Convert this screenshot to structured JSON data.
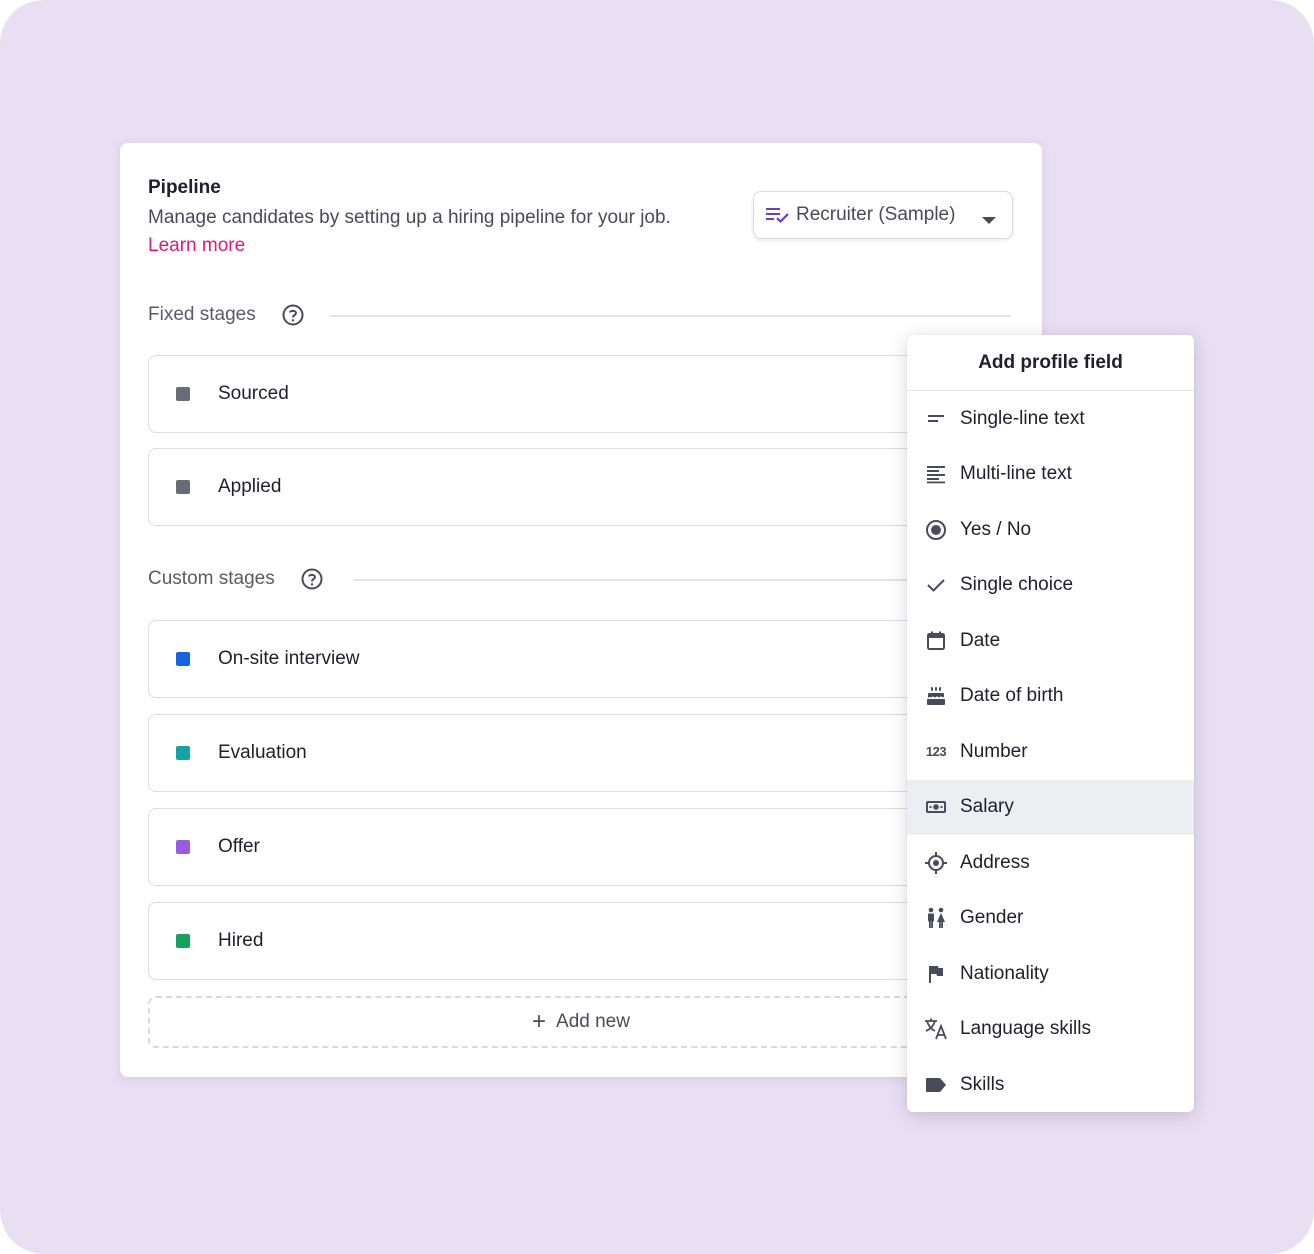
{
  "pipeline": {
    "title": "Pipeline",
    "description": "Manage candidates by setting up a hiring pipeline for your job.",
    "learn_more": "Learn more",
    "template_select": {
      "value": "Recruiter (Sample)",
      "icon": "playlist-check-icon",
      "accent": "#6b3fb8"
    }
  },
  "fixed_stages": {
    "label": "Fixed stages",
    "items": [
      {
        "label": "Sourced",
        "color": "#6b6b78"
      },
      {
        "label": "Applied",
        "color": "#6b6b78"
      }
    ]
  },
  "custom_stages": {
    "label": "Custom stages",
    "items": [
      {
        "label": "On-site interview",
        "color": "#1464e0"
      },
      {
        "label": "Evaluation",
        "color": "#12a3a3"
      },
      {
        "label": "Offer",
        "color": "#9a5ae0"
      },
      {
        "label": "Hired",
        "color": "#16a05a"
      }
    ]
  },
  "add_new": {
    "label": "Add new"
  },
  "profile_field_menu": {
    "title": "Add profile field",
    "highlighted": "Salary",
    "items": [
      {
        "label": "Single-line text",
        "icon": "short-text-icon"
      },
      {
        "label": "Multi-line text",
        "icon": "long-text-icon"
      },
      {
        "label": "Yes / No",
        "icon": "radio-button-icon"
      },
      {
        "label": "Single choice",
        "icon": "checkmark-icon"
      },
      {
        "label": "Date",
        "icon": "calendar-icon"
      },
      {
        "label": "Date of birth",
        "icon": "cake-icon"
      },
      {
        "label": "Number",
        "icon": "number-icon",
        "glyph": "123"
      },
      {
        "label": "Salary",
        "icon": "money-icon"
      },
      {
        "label": "Address",
        "icon": "location-target-icon"
      },
      {
        "label": "Gender",
        "icon": "people-icon"
      },
      {
        "label": "Nationality",
        "icon": "flag-icon"
      },
      {
        "label": "Language skills",
        "icon": "translate-icon"
      },
      {
        "label": "Skills",
        "icon": "label-tag-icon"
      }
    ]
  },
  "colors": {
    "background": "#e9dff3",
    "link": "#d81b7d",
    "text": "#1f1f2e",
    "muted": "#5a5a68"
  }
}
